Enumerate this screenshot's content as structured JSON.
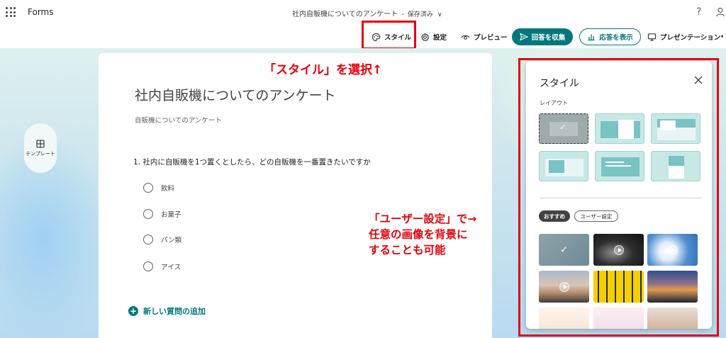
{
  "header": {
    "app_name": "Forms",
    "doc_title": "社内自販機についてのアンケート",
    "separator": "-",
    "save_status": "保存済み",
    "help": "?"
  },
  "toolbar": {
    "style": "スタイル",
    "settings": "設定",
    "preview": "プレビュー",
    "collect": "回答を収集",
    "responses": "応答を表示",
    "present": "プレゼンテーション",
    "more": "·"
  },
  "sidebar": {
    "templates": "テンプレート"
  },
  "form": {
    "title": "社内自販機についてのアンケート",
    "subtitle": "自販機についてのアンケート",
    "question": "1. 社内に自販機を1つ置くとしたら、どの自販機を一番置きたいですか",
    "options": [
      "飲料",
      "お菓子",
      "パン類",
      "アイス"
    ],
    "add_question": "新しい質問の追加"
  },
  "annotations": {
    "select_style": "「スタイル」を選択↑",
    "user_setting_line1": "「ユーザー設定」で→",
    "user_setting_line2": "任意の画像を背景に",
    "user_setting_line3": "することも可能"
  },
  "style_panel": {
    "title": "スタイル",
    "layout_label": "レイアウト",
    "chip_recommended": "おすすめ",
    "chip_custom": "ユーザー設定",
    "layouts": [
      "selected-default",
      "image-right",
      "image-top-right",
      "image-left",
      "banner-text",
      "image-top-center"
    ],
    "selected_layout_index": 0,
    "theme_thumbnails": [
      "slate-gradient",
      "dark-wave-video",
      "sky-clouds-video",
      "beach-sunset-video",
      "yellow-hands",
      "city-night",
      "pastel-illustration",
      "people-illustration",
      "desert-figure"
    ]
  },
  "colors": {
    "accent": "#03787c",
    "annotation_red": "#e8000b"
  }
}
